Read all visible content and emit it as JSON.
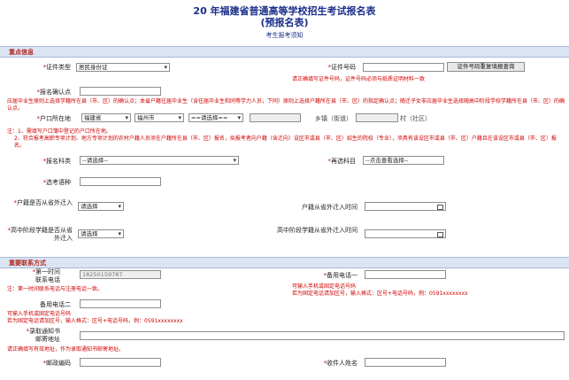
{
  "header": {
    "title_line1": "20  年福建省普通高等学校招生考试报名表",
    "title_line2": "(预报名表)",
    "subtitle": "考生报考须知"
  },
  "section_key": {
    "title": "重点信息",
    "id_type": {
      "label": "证件类型",
      "value": "居民身份证"
    },
    "id_number": {
      "label": "证件号码",
      "value": "",
      "button": "证件号码重复填报查询",
      "note": "请正确填写证件号码，证件号码必须与纸质证明材料一致"
    },
    "confirm_point": {
      "label": "报名确认点",
      "value": ""
    },
    "residence_note": "应届毕业生原则上选择学籍所在县（市、区）的确认点；本省户籍往届毕业生（含往届毕业生和同等学力人员，下同）原则上选择户籍所在县（市、区）的指定确认点；随迁子女非应届毕业生选择随高中阶段学校学籍所在县（市、区）的确认点。",
    "hukou": {
      "label": "户口所在地",
      "province": "福建省",
      "city": "福州市",
      "district": "==请选择==",
      "town_label": "乡镇（街道）",
      "village_label": "村（社区）"
    },
    "hukou_note1": "注：1、需填写户口簿中登记的户口所在地。",
    "hukou_note2": "2、符合报考高职专项计划、地方专项计划的农村户籍人员须在户籍所在县（市、区）报名，拟报考者向户籍（含迁向）设区市或县（市、区）招生的院校（专业），须具有该设区市或县（市、区）户籍且在该设区市或县（市、区）报名。",
    "exam_type": {
      "label": "报名科类",
      "value": "--请选择--"
    },
    "reselect": {
      "label": "再选科目",
      "value": "--点击查看选择--"
    },
    "foreign_lang": {
      "label": "选考语种",
      "value": ""
    },
    "hukou_moved": {
      "label": "户籍是否从省外迁入",
      "value": "请选择"
    },
    "hukou_moved_time": {
      "label": "户籍从省外迁入时间",
      "value": ""
    },
    "school_moved": {
      "label": "高中阶段学籍是否从省外迁入",
      "value": "请选择"
    },
    "school_moved_time": {
      "label": "高中阶段学籍从省外迁入时间",
      "value": ""
    }
  },
  "section_contact": {
    "title": "重要联系方式",
    "phone1": {
      "label_line1": "第一时间",
      "label_line2": "联系电话",
      "value": "18250159787",
      "note": "注：第一时间联系电话与注册电话一致。"
    },
    "backup1": {
      "label": "备用电话一",
      "value": "",
      "note1": "可输入手机或固定电话号码",
      "note2": "若为固定电话请加区号，输入格式：区号+电话号码，例：0591xxxxxxxx"
    },
    "backup2": {
      "label": "备用电话二",
      "value": "",
      "note1": "可输入手机或固定电话号码",
      "note2": "若为固定电话请加区号，输入格式：区号+电话号码，例：0591xxxxxxxx"
    },
    "mail_addr": {
      "label_line1": "录取通知书",
      "label_line2": "邮寄地址",
      "value": "",
      "note": "请正确填写有效地址，作为录取通知书邮寄地址。"
    },
    "postcode": {
      "label": "邮政编码",
      "value": ""
    },
    "recipient": {
      "label": "收件人姓名",
      "value": ""
    }
  },
  "colors": {
    "accent": "#1a2f8a",
    "warning": "#d00000",
    "section_bg": "#dbe4f3"
  }
}
